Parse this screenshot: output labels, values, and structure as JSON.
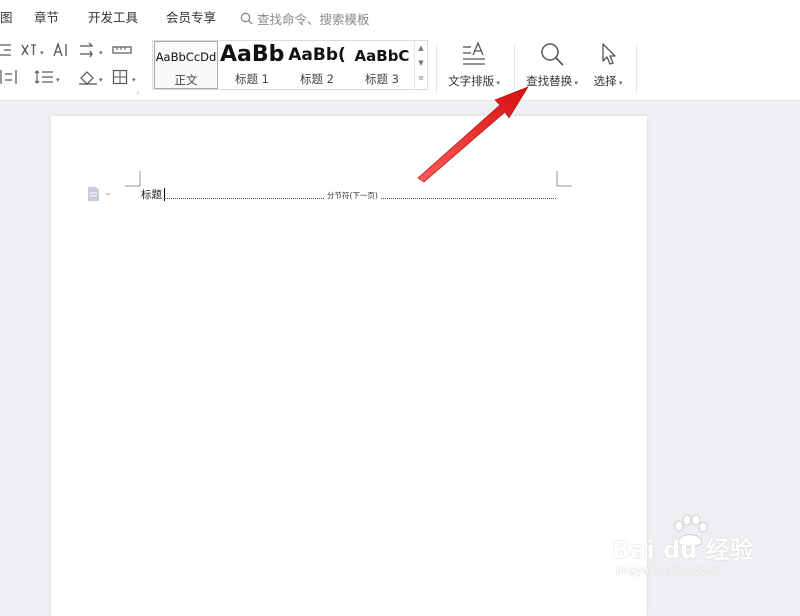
{
  "menubar": {
    "items": [
      "图",
      "章节",
      "开发工具",
      "会员专享"
    ],
    "search_placeholder": "查找命令、搜索模板"
  },
  "ribbon": {
    "styles": [
      {
        "sample": "AaBbCcDd",
        "name": "正文"
      },
      {
        "sample": "AaBb",
        "name": "标题 1"
      },
      {
        "sample": "AaBb(",
        "name": "标题 2"
      },
      {
        "sample": "AaBbC",
        "name": "标题 3"
      }
    ],
    "text_layout_label": "文字排版",
    "find_replace_label": "查找替换",
    "select_label": "选择"
  },
  "document": {
    "text": "标题",
    "section_break_label": "分节符(下一页)"
  },
  "watermark": {
    "brand": "Bai du 经验",
    "url": "jingyan.baidu.com"
  },
  "colors": {
    "arrow": "#e02020",
    "background": "#eeeff2",
    "page": "#ffffff"
  }
}
